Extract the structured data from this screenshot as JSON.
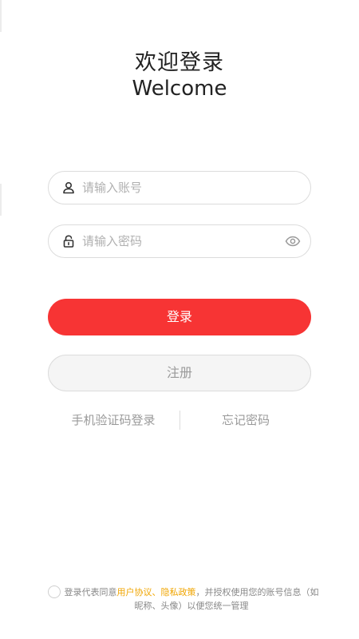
{
  "header": {
    "title_zh": "欢迎登录",
    "title_en": "Welcome"
  },
  "form": {
    "account": {
      "placeholder": "请输入账号",
      "value": "",
      "icon": "user-icon"
    },
    "password": {
      "placeholder": "请输入密码",
      "value": "",
      "icon": "lock-icon",
      "toggle_icon": "eye-icon"
    }
  },
  "actions": {
    "login_label": "登录",
    "register_label": "注册",
    "sms_login_label": "手机验证码登录",
    "forgot_password_label": "忘记密码"
  },
  "agreement": {
    "prefix": "登录代表同意",
    "user_agreement": "用户协议",
    "separator": "、",
    "privacy_policy": "隐私政策",
    "suffix": "，并授权使用您的账号信息（如昵称、头像）以便您统一管理",
    "checked": false
  },
  "colors": {
    "primary": "#f73434",
    "link_highlight": "#f0a500",
    "muted_text": "#9a9a9a",
    "border": "#dcdcdc"
  }
}
